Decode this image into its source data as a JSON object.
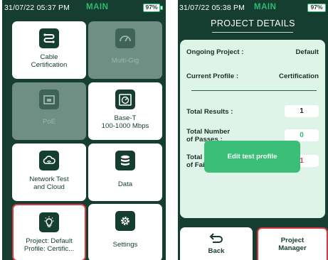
{
  "left_screen": {
    "status": {
      "time": "31/07/22 05:37 PM",
      "mode": "MAIN",
      "battery": "97%"
    },
    "tiles": [
      {
        "label": "Cable\nCertification",
        "icon": "cable-icon"
      },
      {
        "label": "Multi-Gig",
        "icon": "speedometer-icon"
      },
      {
        "label": "PoE",
        "icon": "ethernet-port-icon"
      },
      {
        "label": "Base-T\n100-1000 Mbps",
        "icon": "stopwatch-icon"
      },
      {
        "label": "Network Test\nand Cloud",
        "icon": "cloud-icon"
      },
      {
        "label": "Data",
        "icon": "database-icon"
      },
      {
        "label": "Project: Default\nProfile: Certific...",
        "icon": "lightbulb-icon"
      },
      {
        "label": "Settings",
        "icon": "gear-icon"
      }
    ]
  },
  "right_screen": {
    "status": {
      "time": "31/07/22 05:38 PM",
      "mode": "MAIN",
      "battery": "97%"
    },
    "title": "PROJECT DETAILS",
    "ongoing_project": {
      "label": "Ongoing Project :",
      "value": "Default"
    },
    "current_profile": {
      "label": "Current Profile :",
      "value": "Certification"
    },
    "total_results": {
      "label": "Total Results :",
      "value": "1"
    },
    "total_passes": {
      "label": "Total Number\nof Passes :",
      "value": "0"
    },
    "total_failures": {
      "label": "Total Number\nof Failures :",
      "value": "1"
    },
    "edit_button": "Edit test profile",
    "back_button": "Back",
    "manager_button": "Project\nManager",
    "colors": {
      "pass": "#2fb972",
      "fail": "#e23b4a",
      "accent": "#3bbf78"
    }
  }
}
